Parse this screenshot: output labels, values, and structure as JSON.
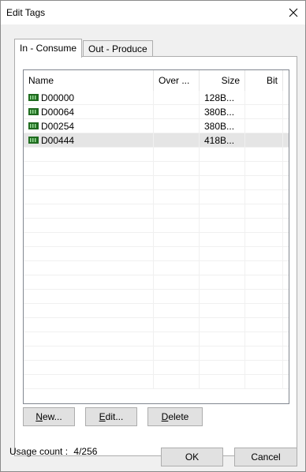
{
  "window": {
    "title": "Edit Tags"
  },
  "tabs": [
    {
      "label": "In - Consume"
    },
    {
      "label": "Out - Produce"
    }
  ],
  "list": {
    "columns": [
      "Name",
      "Over ...",
      "Size",
      "Bit"
    ],
    "rows": [
      {
        "name": "D00000",
        "over": "",
        "size": "128B...",
        "bit": ""
      },
      {
        "name": "D00064",
        "over": "",
        "size": "380B...",
        "bit": ""
      },
      {
        "name": "D00254",
        "over": "",
        "size": "380B...",
        "bit": ""
      },
      {
        "name": "D00444",
        "over": "",
        "size": "418B...",
        "bit": ""
      }
    ]
  },
  "panel_buttons": {
    "new_mnemonic": "N",
    "new_rest": "ew...",
    "edit_mnemonic": "E",
    "edit_rest": "dit...",
    "delete_mnemonic": "D",
    "delete_rest": "elete"
  },
  "footer": {
    "usage_label": "Usage count :",
    "usage_value": "4/256",
    "ok_label": "OK",
    "cancel_label": "Cancel"
  },
  "icons": {
    "close": "close-icon",
    "tag": "tag-icon"
  },
  "colors": {
    "tag_icon": "#1f6b1f",
    "selection": "#e5e5e5",
    "default_button_border": "#0078d7"
  }
}
